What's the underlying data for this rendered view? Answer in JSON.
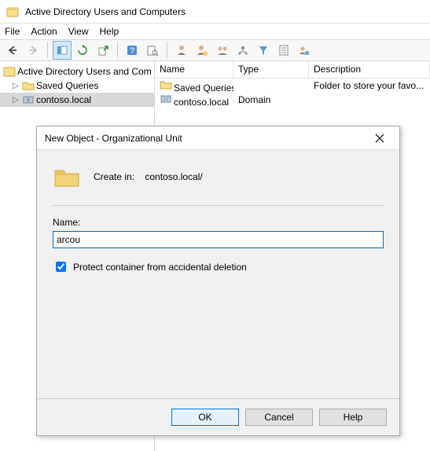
{
  "app": {
    "title": "Active Directory Users and Computers"
  },
  "menu": {
    "file": "File",
    "action": "Action",
    "view": "View",
    "help": "Help"
  },
  "tree": {
    "root": "Active Directory Users and Com",
    "saved_queries": "Saved Queries",
    "domain": "contoso.local"
  },
  "list": {
    "cols": {
      "name": "Name",
      "type": "Type",
      "description": "Description"
    },
    "rows": [
      {
        "name": "Saved Queries",
        "type": "",
        "description": "Folder to store your favo..."
      },
      {
        "name": "contoso.local",
        "type": "Domain",
        "description": ""
      }
    ]
  },
  "dialog": {
    "title": "New Object - Organizational Unit",
    "create_in_label": "Create in:",
    "create_in_value": "contoso.local/",
    "name_label": "Name:",
    "name_value": "arcou",
    "protect_label": "Protect container from accidental deletion",
    "protect_checked": true,
    "buttons": {
      "ok": "OK",
      "cancel": "Cancel",
      "help": "Help"
    }
  },
  "icons": {
    "app": "aduc-icon",
    "back": "back-icon",
    "forward": "forward-icon",
    "showhide": "showhide-icon",
    "refresh": "refresh-icon",
    "export": "export-icon",
    "help": "help-icon",
    "find": "find-icon",
    "u1": "user-icon",
    "u2": "user-add-icon",
    "u3": "group-icon",
    "u4": "ou-icon",
    "filter": "filter-icon",
    "props": "props-icon",
    "u5": "misc-icon"
  }
}
